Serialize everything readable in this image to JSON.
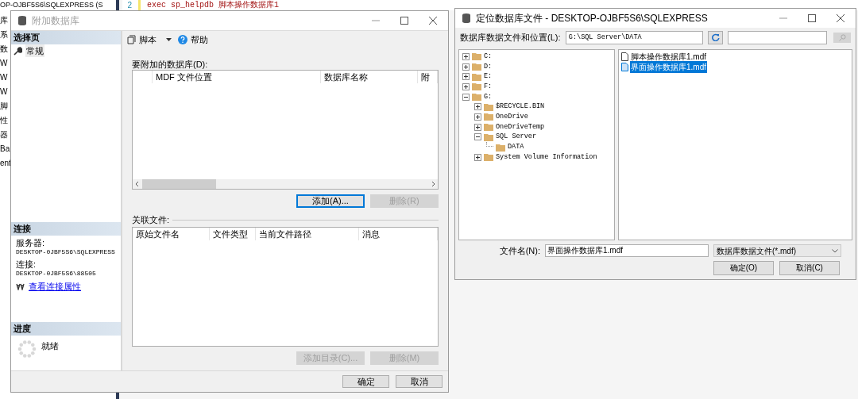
{
  "background": {
    "explorer_title": "OP-OJBF5S6\\SQLEXPRESS (S",
    "explorer_items": [
      "库",
      "系",
      "数",
      "W",
      "W",
      "W",
      "脚",
      "性",
      "器",
      "Ba",
      "ent"
    ],
    "code_line": {
      "number": "2",
      "text": "exec sp_helpdb 脚本操作数据库1"
    }
  },
  "attach_dialog": {
    "title": "附加数据库",
    "active": false,
    "select_page": {
      "header": "选择页",
      "pages": [
        {
          "label": "常规",
          "selected": true
        }
      ]
    },
    "connection": {
      "header": "连接",
      "server_label": "服务器:",
      "server": "DESKTOP-0JBF5S6\\SQLEXPRESS",
      "connection_label": "连接:",
      "connection": "DESKTOP-0JBF5S6\\88505",
      "link": "查看连接属性"
    },
    "progress": {
      "header": "进度",
      "status": "就绪"
    },
    "toolbar": {
      "script": "脚本",
      "help": "帮助"
    },
    "databases": {
      "label": "要附加的数据库(D):",
      "columns": [
        "MDF 文件位置",
        "数据库名称",
        "附"
      ],
      "buttons": [
        {
          "label": "添加(A)...",
          "disabled": false,
          "focused": true
        },
        {
          "label": "删除(R)",
          "disabled": true,
          "focused": false
        }
      ]
    },
    "related_files": {
      "label": "关联文件:",
      "columns": [
        "原始文件名",
        "文件类型",
        "当前文件路径",
        "消息"
      ],
      "buttons": [
        {
          "label": "添加目录(C)...",
          "disabled": true,
          "focused": false
        },
        {
          "label": "删除(M)",
          "disabled": true,
          "focused": false
        }
      ]
    },
    "footer_buttons": [
      "确定",
      "取消"
    ]
  },
  "locate_dialog": {
    "title": "定位数据库文件 - DESKTOP-OJBF5S6\\SQLEXPRESS",
    "active": true,
    "location_label": "数据库数据文件和位置(L):",
    "location": "G:\\SQL Server\\DATA",
    "search_button": {
      "disabled": true
    },
    "tree": [
      {
        "label": "C:",
        "expanded": false
      },
      {
        "label": "D:",
        "expanded": false
      },
      {
        "label": "E:",
        "expanded": false
      },
      {
        "label": "F:",
        "expanded": false
      },
      {
        "label": "G:",
        "expanded": true,
        "children": [
          {
            "label": "$RECYCLE.BIN",
            "expanded": false
          },
          {
            "label": "OneDrive",
            "expanded": false
          },
          {
            "label": "OneDriveTemp",
            "expanded": false
          },
          {
            "label": "SQL Server",
            "expanded": true,
            "children": [
              {
                "label": "DATA"
              }
            ]
          },
          {
            "label": "System Volume Information",
            "expanded": false
          }
        ]
      }
    ],
    "files": [
      {
        "name": "脚本操作数据库1.mdf",
        "selected": false
      },
      {
        "name": "界面操作数据库1.mdf",
        "selected": true
      }
    ],
    "filename_label": "文件名(N):",
    "filename": "界面操作数据库1.mdf",
    "filetype": "数据库数据文件(*.mdf)",
    "buttons": [
      "确定(O)",
      "取消(C)"
    ]
  }
}
